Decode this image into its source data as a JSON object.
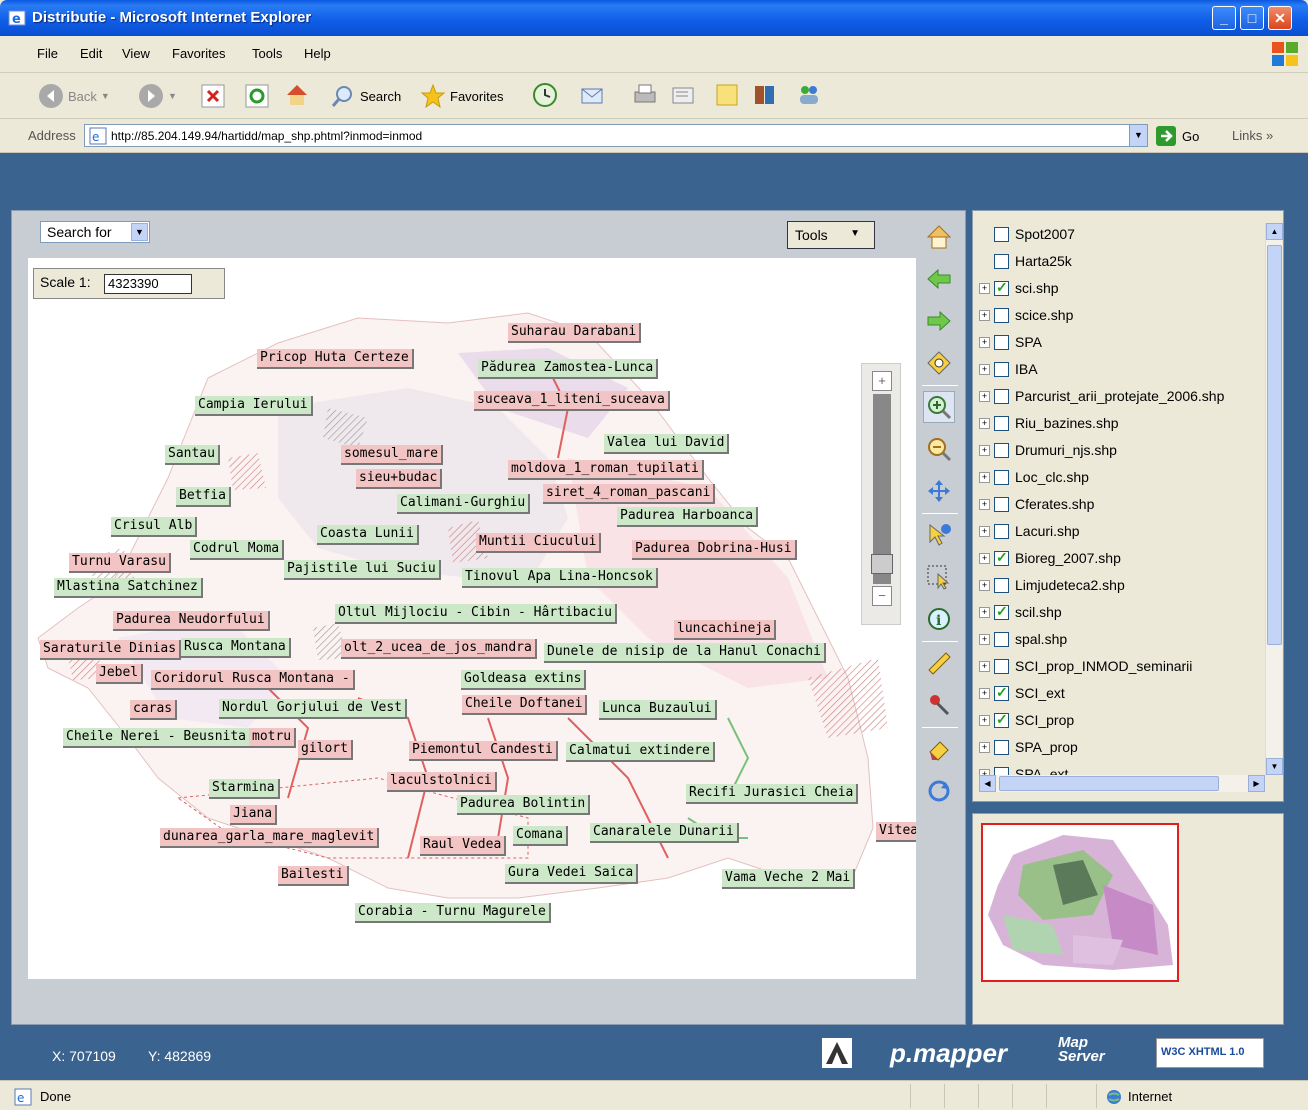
{
  "window": {
    "title": "Distributie - Microsoft Internet Explorer"
  },
  "menu": [
    "File",
    "Edit",
    "View",
    "Favorites",
    "Tools",
    "Help"
  ],
  "toolbar": {
    "back": "Back",
    "search": "Search",
    "favorites": "Favorites"
  },
  "address": {
    "label": "Address",
    "url": "http://85.204.149.94/hartidd/map_shp.phtml?inmod=inmod",
    "go": "Go",
    "links": "Links"
  },
  "map": {
    "search_for": "Search for",
    "tools": "Tools",
    "scale_label": "Scale 1:",
    "scale_value": "4323390",
    "labels": [
      {
        "text": "Suharau Darabani",
        "kind": "p"
      },
      {
        "text": "Pricop Huta Certeze",
        "kind": "p"
      },
      {
        "text": "Pădurea Zamostea-Lunca",
        "kind": "g"
      },
      {
        "text": "Campia Ierului",
        "kind": "g"
      },
      {
        "text": "suceava_1_liteni_suceava",
        "kind": "p"
      },
      {
        "text": "Valea lui David",
        "kind": "g"
      },
      {
        "text": "Santau",
        "kind": "g"
      },
      {
        "text": "somesul_mare",
        "kind": "p"
      },
      {
        "text": "moldova_1_roman_tupilati",
        "kind": "p"
      },
      {
        "text": "sieu+budac",
        "kind": "p"
      },
      {
        "text": "siret_4_roman_pascani",
        "kind": "p"
      },
      {
        "text": "Betfia",
        "kind": "g"
      },
      {
        "text": "Calimani-Gurghiu",
        "kind": "g"
      },
      {
        "text": "Padurea Harboanca",
        "kind": "g"
      },
      {
        "text": "Crisul Alb",
        "kind": "g"
      },
      {
        "text": "Coasta Lunii",
        "kind": "g"
      },
      {
        "text": "Muntii Ciucului",
        "kind": "p"
      },
      {
        "text": "Codrul Moma",
        "kind": "g"
      },
      {
        "text": "Padurea Dobrina-Husi",
        "kind": "p"
      },
      {
        "text": "Turnu Varasu",
        "kind": "p"
      },
      {
        "text": "Pajistile lui  Suciu",
        "kind": "g"
      },
      {
        "text": "Tinovul Apa Lina-Honcsok",
        "kind": "g"
      },
      {
        "text": "Mlastina Satchinez",
        "kind": "g"
      },
      {
        "text": "Oltul Mijlociu - Cibin - Hârtibaciu",
        "kind": "g"
      },
      {
        "text": "Padurea Neudorfului",
        "kind": "p"
      },
      {
        "text": "luncachineja",
        "kind": "p"
      },
      {
        "text": "Saraturile Dinias",
        "kind": "p"
      },
      {
        "text": "Rusca Montana",
        "kind": "g"
      },
      {
        "text": "olt_2_ucea_de_jos_mandra",
        "kind": "p"
      },
      {
        "text": "Dunele de nisip de la Hanul Conachi",
        "kind": "g"
      },
      {
        "text": "Jebel",
        "kind": "p"
      },
      {
        "text": "Coridorul Rusca Montana -",
        "kind": "p"
      },
      {
        "text": "Goldeasa extins",
        "kind": "g"
      },
      {
        "text": "caras",
        "kind": "p"
      },
      {
        "text": "Nordul Gorjului de Vest",
        "kind": "g"
      },
      {
        "text": "Cheile Doftanei",
        "kind": "p"
      },
      {
        "text": "Lunca Buzaului",
        "kind": "g"
      },
      {
        "text": "Cheile Nerei - Beusnita",
        "kind": "g"
      },
      {
        "text": "motru",
        "kind": "p"
      },
      {
        "text": "gilort",
        "kind": "p"
      },
      {
        "text": "Piemontul Candesti",
        "kind": "p"
      },
      {
        "text": "Calmatui extindere",
        "kind": "g"
      },
      {
        "text": "laculstolnici",
        "kind": "p"
      },
      {
        "text": "Starmina",
        "kind": "g"
      },
      {
        "text": "Recifi Jurasici Cheia",
        "kind": "g"
      },
      {
        "text": "Padurea Bolintin",
        "kind": "g"
      },
      {
        "text": "Jiana",
        "kind": "p"
      },
      {
        "text": "dunarea_garla_mare_maglevit",
        "kind": "p"
      },
      {
        "text": "Comana",
        "kind": "g"
      },
      {
        "text": "Canaralele Dunarii",
        "kind": "g"
      },
      {
        "text": "Raul Vedea",
        "kind": "p"
      },
      {
        "text": "Vitea",
        "kind": "p"
      },
      {
        "text": "Bailesti",
        "kind": "p"
      },
      {
        "text": "Gura Vedei Saica",
        "kind": "g"
      },
      {
        "text": "Vama Veche 2 Mai",
        "kind": "g"
      },
      {
        "text": "Corabia - Turnu Magurele",
        "kind": "g"
      }
    ]
  },
  "layers": [
    {
      "name": "Spot2007",
      "expand": false,
      "checked": false
    },
    {
      "name": "Harta25k",
      "expand": false,
      "checked": false
    },
    {
      "name": "sci.shp",
      "expand": true,
      "checked": true
    },
    {
      "name": "scice.shp",
      "expand": true,
      "checked": false
    },
    {
      "name": "SPA",
      "expand": true,
      "checked": false
    },
    {
      "name": "IBA",
      "expand": true,
      "checked": false
    },
    {
      "name": "Parcurist_arii_protejate_2006.shp",
      "expand": true,
      "checked": false
    },
    {
      "name": "Riu_bazines.shp",
      "expand": true,
      "checked": false
    },
    {
      "name": "Drumuri_njs.shp",
      "expand": true,
      "checked": false
    },
    {
      "name": "Loc_clc.shp",
      "expand": true,
      "checked": false
    },
    {
      "name": "Cferates.shp",
      "expand": true,
      "checked": false
    },
    {
      "name": "Lacuri.shp",
      "expand": true,
      "checked": false
    },
    {
      "name": "Bioreg_2007.shp",
      "expand": true,
      "checked": true
    },
    {
      "name": "Limjudeteca2.shp",
      "expand": true,
      "checked": false
    },
    {
      "name": "scil.shp",
      "expand": true,
      "checked": true
    },
    {
      "name": "spal.shp",
      "expand": true,
      "checked": false
    },
    {
      "name": "SCI_prop_INMOD_seminarii",
      "expand": true,
      "checked": false
    },
    {
      "name": "SCI_ext",
      "expand": true,
      "checked": true
    },
    {
      "name": "SCI_prop",
      "expand": true,
      "checked": true
    },
    {
      "name": "SPA_prop",
      "expand": true,
      "checked": false
    },
    {
      "name": "SPA_ext",
      "expand": true,
      "checked": false
    }
  ],
  "footer": {
    "x_label": "X: 707109",
    "y_label": "Y: 482869",
    "brand": "p.mapper",
    "mapserver": "Map Server",
    "xhtml": "W3C XHTML 1.0"
  },
  "status": {
    "done": "Done",
    "zone": "Internet"
  },
  "colors": {
    "page_bg": "#3a648f",
    "label_green": "#cce8c8",
    "label_pink": "#f2c4c4",
    "overview_border": "#e02020"
  }
}
